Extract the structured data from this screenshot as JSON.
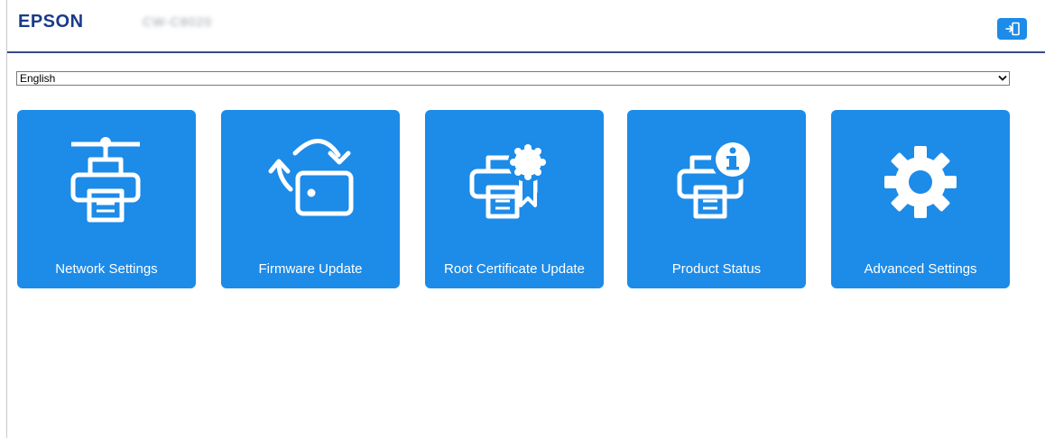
{
  "header": {
    "brand": "EPSON",
    "model": "CW-C8020",
    "logout_icon": "logout-icon"
  },
  "language": {
    "selected": "English"
  },
  "tiles": [
    {
      "label": "Network Settings",
      "icon": "network-printer-icon"
    },
    {
      "label": "Firmware Update",
      "icon": "firmware-update-icon"
    },
    {
      "label": "Root Certificate Update",
      "icon": "certificate-printer-icon"
    },
    {
      "label": "Product Status",
      "icon": "printer-info-icon"
    },
    {
      "label": "Advanced Settings",
      "icon": "gear-icon"
    }
  ],
  "colors": {
    "accent": "#1d8be8",
    "brand": "#1a3a8a",
    "header_rule": "#3a4a8a"
  }
}
